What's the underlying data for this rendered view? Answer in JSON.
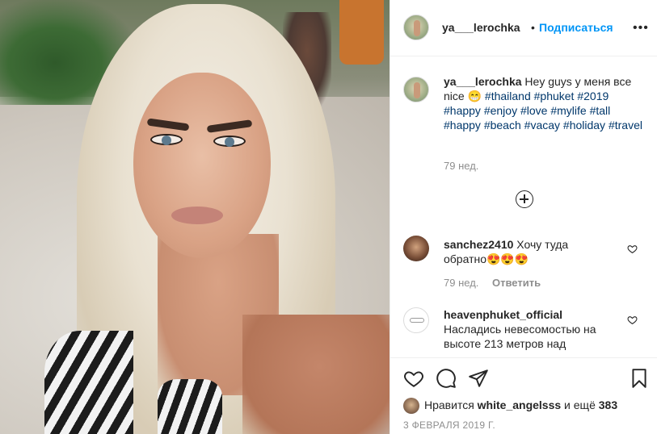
{
  "post": {
    "username": "ya___lerochka",
    "separator": "•",
    "follow_label": "Подписаться",
    "more_label": "•••"
  },
  "caption": {
    "username": "ya___lerochka",
    "text_lead": "Hey guys у меня все nice 😁",
    "hashtags": [
      "#thailand",
      "#phuket",
      "#2019",
      "#happy",
      "#enjoy",
      "#love",
      "#mylife",
      "#tall",
      "#happy",
      "#beach",
      "#vacay",
      "#holiday",
      "#travel"
    ],
    "time": "79 нед."
  },
  "load_more_icon": "plus-circle-icon",
  "comments": [
    {
      "username": "sanchez2410",
      "text": "Хочу туда обратно😍😍😍",
      "time": "79 нед.",
      "reply_label": "Ответить"
    },
    {
      "username": "heavenphuket_official",
      "text": "Насладись невесомостью на высоте 213 метров над"
    }
  ],
  "likes": {
    "prefix": "Нравится ",
    "user": "white_angelsss",
    "middle": " и ещё ",
    "count": "383"
  },
  "date": "3 ФЕВРАЛЯ 2019 Г.",
  "icons": [
    "heart-icon",
    "comment-icon",
    "share-icon",
    "bookmark-icon"
  ],
  "colors": {
    "link": "#00376b",
    "follow": "#0095f6",
    "muted": "#8e8e8e"
  }
}
